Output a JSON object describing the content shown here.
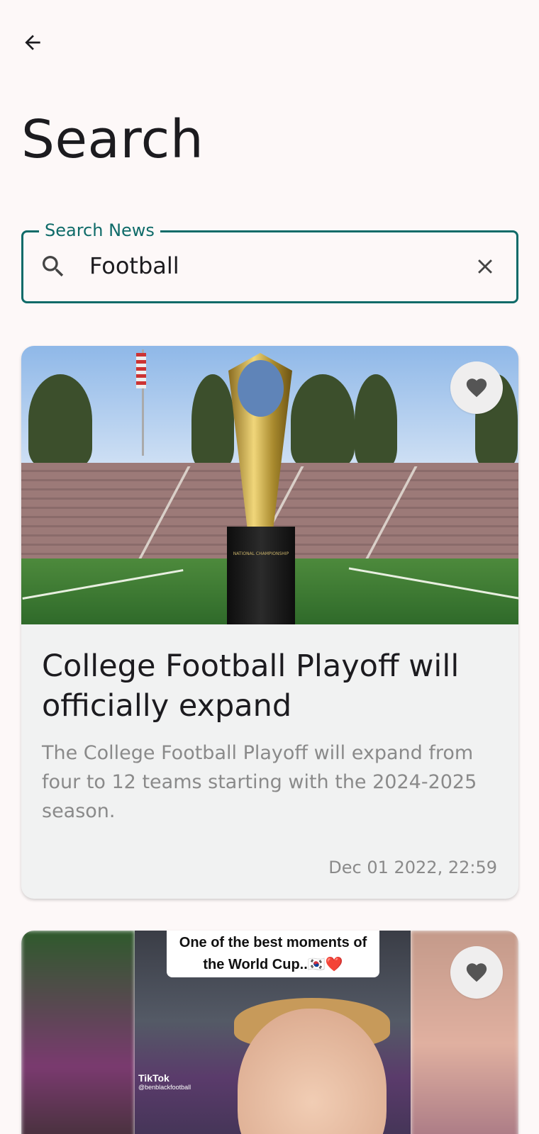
{
  "header": {
    "back_icon": "arrow-back-icon",
    "title": "Search"
  },
  "search": {
    "label": "Search News",
    "value": "Football",
    "search_icon": "search-icon",
    "clear_icon": "close-icon"
  },
  "articles": [
    {
      "title": "College Football Playoff will officially expand",
      "description": "The College Football Playoff will expand from four to 12 teams starting with the 2024-2025 season.",
      "date": "Dec 01 2022, 22:59",
      "favorite_icon": "heart-icon",
      "trophy_text": "NATIONAL CHAMPIONSHIP"
    },
    {
      "image_caption": "One of the best moments of the World Cup..🇰🇷❤️",
      "tiktok_label": "TikTok",
      "tiktok_handle": "@benblackfootball",
      "favorite_icon": "heart-icon"
    }
  ],
  "colors": {
    "accent": "#0f6b69",
    "background": "#fdf8f8",
    "card": "#f1f2f2",
    "muted_text": "#8a8a8a"
  }
}
